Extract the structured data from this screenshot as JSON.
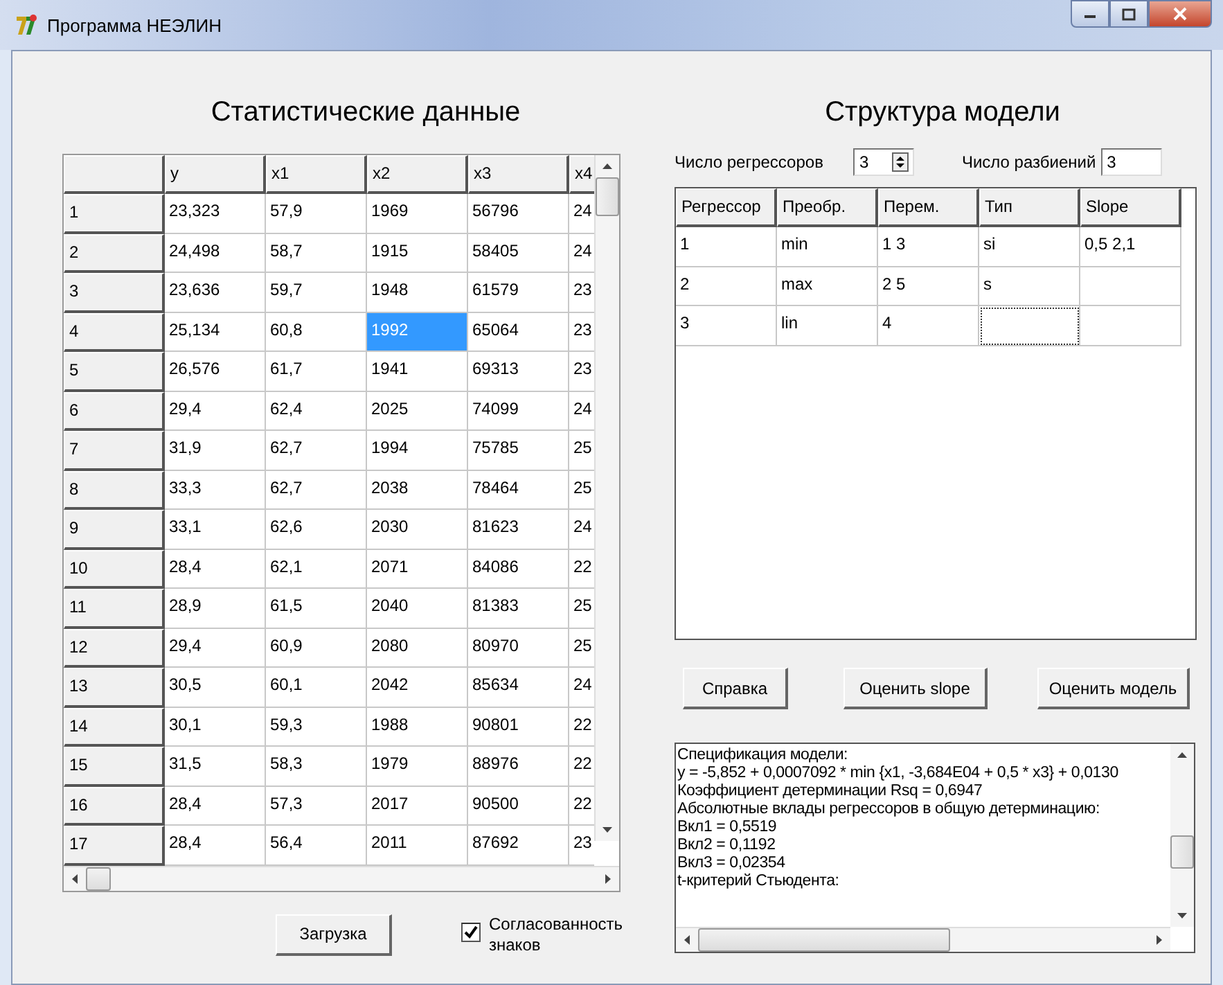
{
  "window": {
    "title": "Программа НЕЭЛИН"
  },
  "data_panel": {
    "title": "Статистические данные",
    "columns": [
      "y",
      "x1",
      "x2",
      "x3",
      "x4"
    ],
    "rows": [
      {
        "label": "1",
        "cells": [
          {
            "text": "23,323",
            "selected": false
          },
          {
            "text": "57,9",
            "selected": false
          },
          {
            "text": "1969",
            "selected": false
          },
          {
            "text": "56796",
            "selected": false
          },
          {
            "text": "24",
            "selected": false
          }
        ]
      },
      {
        "label": "2",
        "cells": [
          {
            "text": "24,498",
            "selected": false
          },
          {
            "text": "58,7",
            "selected": false
          },
          {
            "text": "1915",
            "selected": false
          },
          {
            "text": "58405",
            "selected": false
          },
          {
            "text": "24",
            "selected": false
          }
        ]
      },
      {
        "label": "3",
        "cells": [
          {
            "text": "23,636",
            "selected": false
          },
          {
            "text": "59,7",
            "selected": false
          },
          {
            "text": "1948",
            "selected": false
          },
          {
            "text": "61579",
            "selected": false
          },
          {
            "text": "23",
            "selected": false
          }
        ]
      },
      {
        "label": "4",
        "cells": [
          {
            "text": "25,134",
            "selected": false
          },
          {
            "text": "60,8",
            "selected": false
          },
          {
            "text": "1992",
            "selected": true
          },
          {
            "text": "65064",
            "selected": false
          },
          {
            "text": "23",
            "selected": false
          }
        ]
      },
      {
        "label": "5",
        "cells": [
          {
            "text": "26,576",
            "selected": false
          },
          {
            "text": "61,7",
            "selected": false
          },
          {
            "text": "1941",
            "selected": false
          },
          {
            "text": "69313",
            "selected": false
          },
          {
            "text": "23",
            "selected": false
          }
        ]
      },
      {
        "label": "6",
        "cells": [
          {
            "text": "29,4",
            "selected": false
          },
          {
            "text": "62,4",
            "selected": false
          },
          {
            "text": "2025",
            "selected": false
          },
          {
            "text": "74099",
            "selected": false
          },
          {
            "text": "24",
            "selected": false
          }
        ]
      },
      {
        "label": "7",
        "cells": [
          {
            "text": "31,9",
            "selected": false
          },
          {
            "text": "62,7",
            "selected": false
          },
          {
            "text": "1994",
            "selected": false
          },
          {
            "text": "75785",
            "selected": false
          },
          {
            "text": "25",
            "selected": false
          }
        ]
      },
      {
        "label": "8",
        "cells": [
          {
            "text": "33,3",
            "selected": false
          },
          {
            "text": "62,7",
            "selected": false
          },
          {
            "text": "2038",
            "selected": false
          },
          {
            "text": "78464",
            "selected": false
          },
          {
            "text": "25",
            "selected": false
          }
        ]
      },
      {
        "label": "9",
        "cells": [
          {
            "text": "33,1",
            "selected": false
          },
          {
            "text": "62,6",
            "selected": false
          },
          {
            "text": "2030",
            "selected": false
          },
          {
            "text": "81623",
            "selected": false
          },
          {
            "text": "24",
            "selected": false
          }
        ]
      },
      {
        "label": "10",
        "cells": [
          {
            "text": "28,4",
            "selected": false
          },
          {
            "text": "62,1",
            "selected": false
          },
          {
            "text": "2071",
            "selected": false
          },
          {
            "text": "84086",
            "selected": false
          },
          {
            "text": "22",
            "selected": false
          }
        ]
      },
      {
        "label": "11",
        "cells": [
          {
            "text": "28,9",
            "selected": false
          },
          {
            "text": "61,5",
            "selected": false
          },
          {
            "text": "2040",
            "selected": false
          },
          {
            "text": "81383",
            "selected": false
          },
          {
            "text": "25",
            "selected": false
          }
        ]
      },
      {
        "label": "12",
        "cells": [
          {
            "text": "29,4",
            "selected": false
          },
          {
            "text": "60,9",
            "selected": false
          },
          {
            "text": "2080",
            "selected": false
          },
          {
            "text": "80970",
            "selected": false
          },
          {
            "text": "25",
            "selected": false
          }
        ]
      },
      {
        "label": "13",
        "cells": [
          {
            "text": "30,5",
            "selected": false
          },
          {
            "text": "60,1",
            "selected": false
          },
          {
            "text": "2042",
            "selected": false
          },
          {
            "text": "85634",
            "selected": false
          },
          {
            "text": "24",
            "selected": false
          }
        ]
      },
      {
        "label": "14",
        "cells": [
          {
            "text": "30,1",
            "selected": false
          },
          {
            "text": "59,3",
            "selected": false
          },
          {
            "text": "1988",
            "selected": false
          },
          {
            "text": "90801",
            "selected": false
          },
          {
            "text": "22",
            "selected": false
          }
        ]
      },
      {
        "label": "15",
        "cells": [
          {
            "text": "31,5",
            "selected": false
          },
          {
            "text": "58,3",
            "selected": false
          },
          {
            "text": "1979",
            "selected": false
          },
          {
            "text": "88976",
            "selected": false
          },
          {
            "text": "22",
            "selected": false
          }
        ]
      },
      {
        "label": "16",
        "cells": [
          {
            "text": "28,4",
            "selected": false
          },
          {
            "text": "57,3",
            "selected": false
          },
          {
            "text": "2017",
            "selected": false
          },
          {
            "text": "90500",
            "selected": false
          },
          {
            "text": "22",
            "selected": false
          }
        ]
      },
      {
        "label": "17",
        "cells": [
          {
            "text": "28,4",
            "selected": false
          },
          {
            "text": "56,4",
            "selected": false
          },
          {
            "text": "2011",
            "selected": false
          },
          {
            "text": "87692",
            "selected": false
          },
          {
            "text": "23",
            "selected": false
          }
        ]
      }
    ],
    "load_button": "Загрузка",
    "sign_checkbox": {
      "label": "Согласованность знаков",
      "checked": true
    }
  },
  "model_panel": {
    "title": "Структура модели",
    "regressor_count": {
      "label": "Число регрессоров",
      "value": "3"
    },
    "partition_count": {
      "label": "Число разбиений",
      "value": "3"
    },
    "columns": [
      "Регрессор",
      "Преобр.",
      "Перем.",
      "Тип",
      "Slope"
    ],
    "rows": [
      {
        "cells": [
          {
            "text": "1",
            "focused": false
          },
          {
            "text": "min",
            "focused": false
          },
          {
            "text": "1 3",
            "focused": false
          },
          {
            "text": "si",
            "focused": false
          },
          {
            "text": "0,5 2,1",
            "focused": false
          }
        ]
      },
      {
        "cells": [
          {
            "text": "2",
            "focused": false
          },
          {
            "text": "max",
            "focused": false
          },
          {
            "text": "2 5",
            "focused": false
          },
          {
            "text": "s",
            "focused": false
          },
          {
            "focused": false
          }
        ]
      },
      {
        "cells": [
          {
            "text": "3",
            "focused": false
          },
          {
            "text": "lin",
            "focused": false
          },
          {
            "text": "4",
            "focused": false
          },
          {
            "focused": true
          },
          {
            "focused": false
          }
        ]
      }
    ],
    "buttons": [
      "Справка",
      "Оценить slope",
      "Оценить модель"
    ],
    "output_lines": [
      "Спецификация модели:",
      "y = -5,852 + 0,0007092 * min {x1, -3,684E04 + 0,5 * x3} + 0,0130",
      "Коэффициент детерминации Rsq = 0,6947",
      "Абсолютные вклады регрессоров в общую детерминацию:",
      "Вкл1 = 0,5519",
      "Вкл2 = 0,1192",
      "Вкл3 = 0,02354",
      "t-критерий Стьюдента:"
    ]
  }
}
